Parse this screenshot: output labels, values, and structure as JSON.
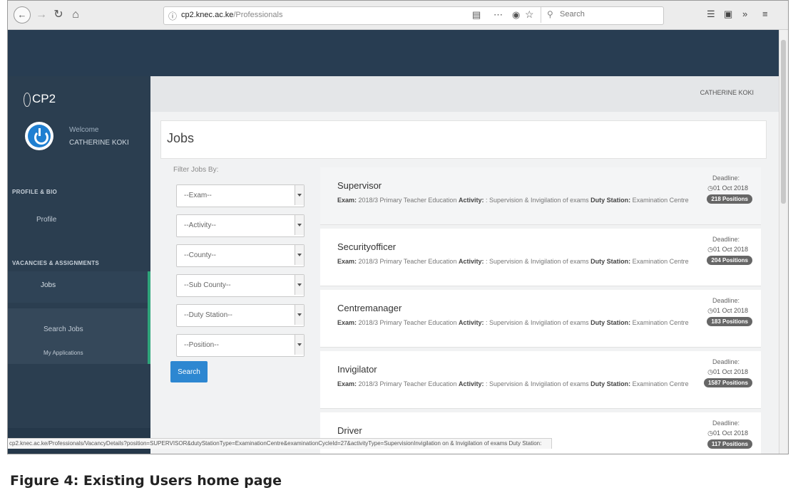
{
  "browser": {
    "url_host": "cp2.knec.ac.ke",
    "url_path": "/Professionals",
    "search_placeholder": "Search",
    "status_url": "cp2.knec.ac.ke/Professionals/VacancyDetails?position=SUPERVISOR&dutyStationType=ExaminationCentre&examinationCycleId=27&activityType=SupervisionInvigilation on & Invigilation of exams Duty Station:"
  },
  "app": {
    "brand": "CP2",
    "welcome": "Welcome",
    "user_name": "CATHERINE KOKI",
    "top_user": "CATHERINE KOKI"
  },
  "sidebar": {
    "section1": "PROFILE & BIO",
    "profile": "Profile",
    "section2": "VACANCIES & ASSIGNMENTS",
    "jobs": "Jobs",
    "search_jobs": "Search Jobs",
    "my_applications": "My Applications"
  },
  "page": {
    "title": "Jobs",
    "filter_label": "Filter Jobs By:",
    "search_button": "Search"
  },
  "filters": [
    "--Exam--",
    "--Activity--",
    "--County--",
    "--Sub County--",
    "--Duty Station--",
    "--Position--"
  ],
  "labels": {
    "exam": "Exam:",
    "activity": "Activity:",
    "duty_station": "Duty Station:",
    "deadline": "Deadline:"
  },
  "jobs": [
    {
      "title": "Supervisor",
      "exam": "2018/3 Primary Teacher Education",
      "activity": ": Supervision & Invigilation of exams",
      "station": "Examination Centre",
      "deadline": "01 Oct 2018",
      "positions": "218 Positions"
    },
    {
      "title": "Securityofficer",
      "exam": "2018/3 Primary Teacher Education",
      "activity": ": Supervision & Invigilation of exams",
      "station": "Examination Centre",
      "deadline": "01 Oct 2018",
      "positions": "204 Positions"
    },
    {
      "title": "Centremanager",
      "exam": "2018/3 Primary Teacher Education",
      "activity": ": Supervision & Invigilation of exams",
      "station": "Examination Centre",
      "deadline": "01 Oct 2018",
      "positions": "183 Positions"
    },
    {
      "title": "Invigilator",
      "exam": "2018/3 Primary Teacher Education",
      "activity": ": Supervision & Invigilation of exams",
      "station": "Examination Centre",
      "deadline": "01 Oct 2018",
      "positions": "1587 Positions"
    },
    {
      "title": "Driver",
      "exam": "",
      "activity": "",
      "station": "",
      "deadline": "01 Oct 2018",
      "positions": "117 Positions"
    }
  ],
  "caption": "Figure 4: Existing Users home page"
}
